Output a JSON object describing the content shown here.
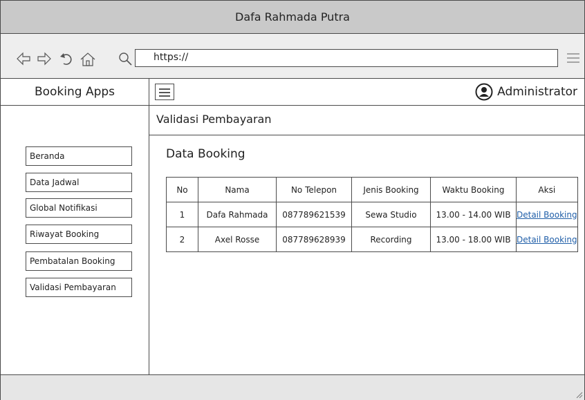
{
  "window": {
    "title": "Dafa Rahmada Putra"
  },
  "browser": {
    "url": "https://"
  },
  "sidebar": {
    "brand": "Booking Apps",
    "items": [
      {
        "label": "Beranda"
      },
      {
        "label": "Data Jadwal"
      },
      {
        "label": "Global Notifikasi"
      },
      {
        "label": "Riwayat Booking"
      },
      {
        "label": "Pembatalan Booking"
      },
      {
        "label": "Validasi Pembayaran"
      }
    ]
  },
  "header": {
    "user": "Administrator"
  },
  "main": {
    "breadcrumb": "Validasi Pembayaran",
    "section_title": "Data Booking",
    "table": {
      "columns": [
        "No",
        "Nama",
        "No Telepon",
        "Jenis Booking",
        "Waktu Booking",
        "Aksi"
      ],
      "rows": [
        [
          "1",
          "Dafa Rahmada",
          "087789621539",
          "Sewa Studio",
          "13.00 - 14.00 WIB",
          "Detail Booking"
        ],
        [
          "2",
          "Axel Rosse",
          "087789628939",
          "Recording",
          "13.00 - 18.00 WIB",
          "Detail Booking"
        ]
      ]
    }
  },
  "icons": {
    "back": "arrow-left-icon",
    "forward": "arrow-right-icon",
    "reload": "reload-icon",
    "home": "home-icon",
    "search": "search-icon",
    "menu": "hamburger-menu-icon",
    "user": "user-avatar-icon",
    "resize": "resize-grip-icon"
  },
  "colors": {
    "titlebar": "#c9c9c9",
    "toolbar": "#eeeeee",
    "link": "#1f5ea8",
    "border": "#4a4a4a"
  }
}
